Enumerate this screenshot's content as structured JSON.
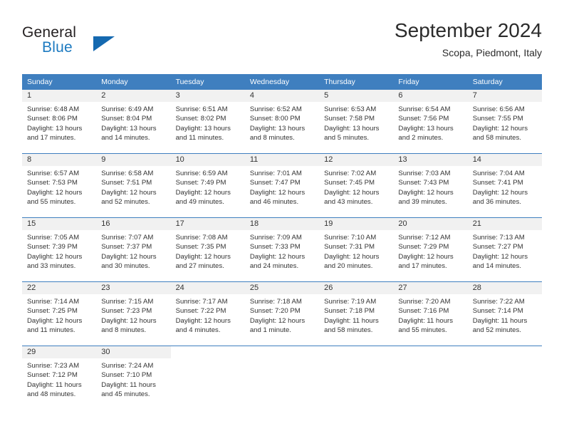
{
  "brand": {
    "word1": "General",
    "word2": "Blue",
    "logo_icon": "triangle-logo-icon",
    "accent_color": "#1569b0"
  },
  "header": {
    "title": "September 2024",
    "subtitle": "Scopa, Piedmont, Italy"
  },
  "theme": {
    "header_bg": "#3f7fbf",
    "daynum_bg": "#f1f1f1",
    "text": "#333333"
  },
  "weekday_headers": [
    "Sunday",
    "Monday",
    "Tuesday",
    "Wednesday",
    "Thursday",
    "Friday",
    "Saturday"
  ],
  "weeks": [
    [
      {
        "day": "1",
        "sunrise": "Sunrise: 6:48 AM",
        "sunset": "Sunset: 8:06 PM",
        "daylight1": "Daylight: 13 hours",
        "daylight2": "and 17 minutes."
      },
      {
        "day": "2",
        "sunrise": "Sunrise: 6:49 AM",
        "sunset": "Sunset: 8:04 PM",
        "daylight1": "Daylight: 13 hours",
        "daylight2": "and 14 minutes."
      },
      {
        "day": "3",
        "sunrise": "Sunrise: 6:51 AM",
        "sunset": "Sunset: 8:02 PM",
        "daylight1": "Daylight: 13 hours",
        "daylight2": "and 11 minutes."
      },
      {
        "day": "4",
        "sunrise": "Sunrise: 6:52 AM",
        "sunset": "Sunset: 8:00 PM",
        "daylight1": "Daylight: 13 hours",
        "daylight2": "and 8 minutes."
      },
      {
        "day": "5",
        "sunrise": "Sunrise: 6:53 AM",
        "sunset": "Sunset: 7:58 PM",
        "daylight1": "Daylight: 13 hours",
        "daylight2": "and 5 minutes."
      },
      {
        "day": "6",
        "sunrise": "Sunrise: 6:54 AM",
        "sunset": "Sunset: 7:56 PM",
        "daylight1": "Daylight: 13 hours",
        "daylight2": "and 2 minutes."
      },
      {
        "day": "7",
        "sunrise": "Sunrise: 6:56 AM",
        "sunset": "Sunset: 7:55 PM",
        "daylight1": "Daylight: 12 hours",
        "daylight2": "and 58 minutes."
      }
    ],
    [
      {
        "day": "8",
        "sunrise": "Sunrise: 6:57 AM",
        "sunset": "Sunset: 7:53 PM",
        "daylight1": "Daylight: 12 hours",
        "daylight2": "and 55 minutes."
      },
      {
        "day": "9",
        "sunrise": "Sunrise: 6:58 AM",
        "sunset": "Sunset: 7:51 PM",
        "daylight1": "Daylight: 12 hours",
        "daylight2": "and 52 minutes."
      },
      {
        "day": "10",
        "sunrise": "Sunrise: 6:59 AM",
        "sunset": "Sunset: 7:49 PM",
        "daylight1": "Daylight: 12 hours",
        "daylight2": "and 49 minutes."
      },
      {
        "day": "11",
        "sunrise": "Sunrise: 7:01 AM",
        "sunset": "Sunset: 7:47 PM",
        "daylight1": "Daylight: 12 hours",
        "daylight2": "and 46 minutes."
      },
      {
        "day": "12",
        "sunrise": "Sunrise: 7:02 AM",
        "sunset": "Sunset: 7:45 PM",
        "daylight1": "Daylight: 12 hours",
        "daylight2": "and 43 minutes."
      },
      {
        "day": "13",
        "sunrise": "Sunrise: 7:03 AM",
        "sunset": "Sunset: 7:43 PM",
        "daylight1": "Daylight: 12 hours",
        "daylight2": "and 39 minutes."
      },
      {
        "day": "14",
        "sunrise": "Sunrise: 7:04 AM",
        "sunset": "Sunset: 7:41 PM",
        "daylight1": "Daylight: 12 hours",
        "daylight2": "and 36 minutes."
      }
    ],
    [
      {
        "day": "15",
        "sunrise": "Sunrise: 7:05 AM",
        "sunset": "Sunset: 7:39 PM",
        "daylight1": "Daylight: 12 hours",
        "daylight2": "and 33 minutes."
      },
      {
        "day": "16",
        "sunrise": "Sunrise: 7:07 AM",
        "sunset": "Sunset: 7:37 PM",
        "daylight1": "Daylight: 12 hours",
        "daylight2": "and 30 minutes."
      },
      {
        "day": "17",
        "sunrise": "Sunrise: 7:08 AM",
        "sunset": "Sunset: 7:35 PM",
        "daylight1": "Daylight: 12 hours",
        "daylight2": "and 27 minutes."
      },
      {
        "day": "18",
        "sunrise": "Sunrise: 7:09 AM",
        "sunset": "Sunset: 7:33 PM",
        "daylight1": "Daylight: 12 hours",
        "daylight2": "and 24 minutes."
      },
      {
        "day": "19",
        "sunrise": "Sunrise: 7:10 AM",
        "sunset": "Sunset: 7:31 PM",
        "daylight1": "Daylight: 12 hours",
        "daylight2": "and 20 minutes."
      },
      {
        "day": "20",
        "sunrise": "Sunrise: 7:12 AM",
        "sunset": "Sunset: 7:29 PM",
        "daylight1": "Daylight: 12 hours",
        "daylight2": "and 17 minutes."
      },
      {
        "day": "21",
        "sunrise": "Sunrise: 7:13 AM",
        "sunset": "Sunset: 7:27 PM",
        "daylight1": "Daylight: 12 hours",
        "daylight2": "and 14 minutes."
      }
    ],
    [
      {
        "day": "22",
        "sunrise": "Sunrise: 7:14 AM",
        "sunset": "Sunset: 7:25 PM",
        "daylight1": "Daylight: 12 hours",
        "daylight2": "and 11 minutes."
      },
      {
        "day": "23",
        "sunrise": "Sunrise: 7:15 AM",
        "sunset": "Sunset: 7:23 PM",
        "daylight1": "Daylight: 12 hours",
        "daylight2": "and 8 minutes."
      },
      {
        "day": "24",
        "sunrise": "Sunrise: 7:17 AM",
        "sunset": "Sunset: 7:22 PM",
        "daylight1": "Daylight: 12 hours",
        "daylight2": "and 4 minutes."
      },
      {
        "day": "25",
        "sunrise": "Sunrise: 7:18 AM",
        "sunset": "Sunset: 7:20 PM",
        "daylight1": "Daylight: 12 hours",
        "daylight2": "and 1 minute."
      },
      {
        "day": "26",
        "sunrise": "Sunrise: 7:19 AM",
        "sunset": "Sunset: 7:18 PM",
        "daylight1": "Daylight: 11 hours",
        "daylight2": "and 58 minutes."
      },
      {
        "day": "27",
        "sunrise": "Sunrise: 7:20 AM",
        "sunset": "Sunset: 7:16 PM",
        "daylight1": "Daylight: 11 hours",
        "daylight2": "and 55 minutes."
      },
      {
        "day": "28",
        "sunrise": "Sunrise: 7:22 AM",
        "sunset": "Sunset: 7:14 PM",
        "daylight1": "Daylight: 11 hours",
        "daylight2": "and 52 minutes."
      }
    ],
    [
      {
        "day": "29",
        "sunrise": "Sunrise: 7:23 AM",
        "sunset": "Sunset: 7:12 PM",
        "daylight1": "Daylight: 11 hours",
        "daylight2": "and 48 minutes."
      },
      {
        "day": "30",
        "sunrise": "Sunrise: 7:24 AM",
        "sunset": "Sunset: 7:10 PM",
        "daylight1": "Daylight: 11 hours",
        "daylight2": "and 45 minutes."
      },
      {
        "day": "",
        "sunrise": "",
        "sunset": "",
        "daylight1": "",
        "daylight2": ""
      },
      {
        "day": "",
        "sunrise": "",
        "sunset": "",
        "daylight1": "",
        "daylight2": ""
      },
      {
        "day": "",
        "sunrise": "",
        "sunset": "",
        "daylight1": "",
        "daylight2": ""
      },
      {
        "day": "",
        "sunrise": "",
        "sunset": "",
        "daylight1": "",
        "daylight2": ""
      },
      {
        "day": "",
        "sunrise": "",
        "sunset": "",
        "daylight1": "",
        "daylight2": ""
      }
    ]
  ]
}
